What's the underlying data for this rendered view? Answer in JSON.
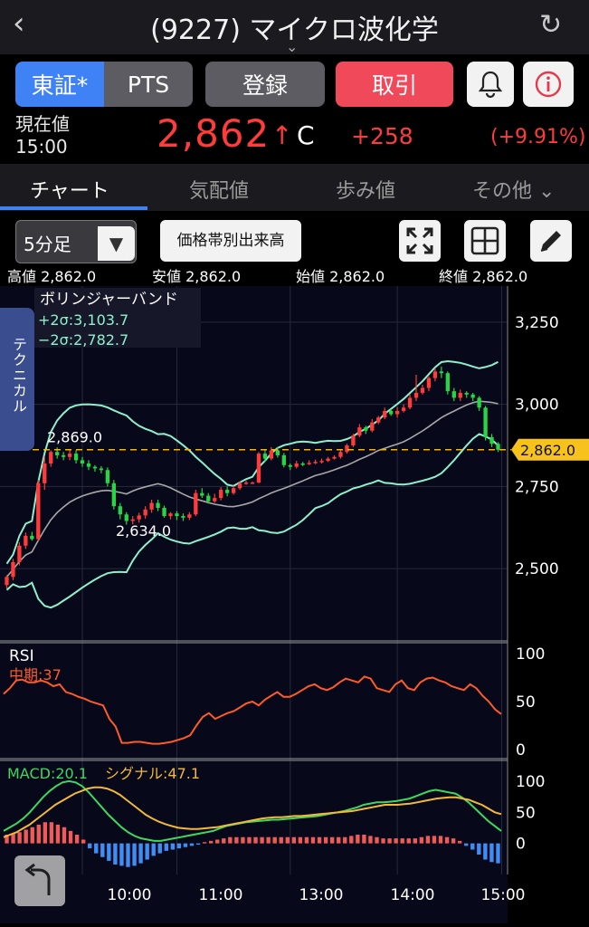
{
  "header": {
    "back_icon": "chevron-left-icon",
    "title": "(9227) マイクロ波化学",
    "reload_icon": "reload-icon"
  },
  "buttons": {
    "tse": "東証*",
    "pts": "PTS",
    "register": "登録",
    "trade": "取引"
  },
  "price": {
    "label_now": "現在値",
    "time": "15:00",
    "value": "2,862",
    "mark": "C",
    "change": "+258",
    "change_pct": "(+9.91%)",
    "up_color": "#ff3b3b"
  },
  "tabs": [
    "チャート",
    "気配値",
    "歩み値",
    "その他"
  ],
  "toolbar": {
    "interval": "5分足",
    "volume_by_price": "価格帯別出来高"
  },
  "ohlc": {
    "high_lbl": "高値",
    "high": "2,862.0",
    "low_lbl": "安値",
    "low": "2,862.0",
    "open_lbl": "始値",
    "open": "2,862.0",
    "close_lbl": "終値",
    "close": "2,862.0"
  },
  "technical_tab": "テクニカル",
  "chart_data": {
    "type": "candlestick",
    "x_ticks": [
      "10:00",
      "11:00",
      "13:00",
      "14:00",
      "15:00"
    ],
    "price_axis": {
      "ticks": [
        "3,250",
        "3,000",
        "2,750",
        "2,500"
      ],
      "values": [
        3250,
        3000,
        2750,
        2500
      ],
      "ylim": [
        2280,
        3360
      ]
    },
    "bollinger": {
      "title": "ボリンジャーバンド",
      "upper_label": "+2σ:3,103.7",
      "lower_label": "−2σ:2,782.7"
    },
    "annotations": {
      "high_mark": "2,869.0",
      "low_mark": "2,634.0",
      "current": "2,862.0",
      "current_value": 2862
    },
    "candles": [
      [
        2450,
        2475,
        2440,
        2480
      ],
      [
        2475,
        2520,
        2465,
        2530
      ],
      [
        2520,
        2570,
        2510,
        2580
      ],
      [
        2570,
        2600,
        2560,
        2610
      ],
      [
        2600,
        2590,
        2585,
        2612
      ],
      [
        2590,
        2760,
        2585,
        2770
      ],
      [
        2760,
        2820,
        2740,
        2840
      ],
      [
        2820,
        2855,
        2810,
        2860
      ],
      [
        2855,
        2845,
        2835,
        2869
      ],
      [
        2845,
        2840,
        2830,
        2855
      ],
      [
        2840,
        2850,
        2830,
        2860
      ],
      [
        2850,
        2830,
        2820,
        2860
      ],
      [
        2830,
        2820,
        2810,
        2840
      ],
      [
        2820,
        2810,
        2800,
        2830
      ],
      [
        2810,
        2805,
        2795,
        2815
      ],
      [
        2805,
        2800,
        2790,
        2812
      ],
      [
        2800,
        2760,
        2750,
        2808
      ],
      [
        2760,
        2690,
        2680,
        2770
      ],
      [
        2690,
        2665,
        2650,
        2700
      ],
      [
        2665,
        2645,
        2634,
        2672
      ],
      [
        2645,
        2650,
        2635,
        2660
      ],
      [
        2650,
        2662,
        2640,
        2670
      ],
      [
        2662,
        2680,
        2652,
        2690
      ],
      [
        2680,
        2700,
        2670,
        2710
      ],
      [
        2700,
        2685,
        2675,
        2710
      ],
      [
        2685,
        2660,
        2655,
        2692
      ],
      [
        2660,
        2668,
        2650,
        2672
      ],
      [
        2668,
        2660,
        2648,
        2675
      ],
      [
        2660,
        2655,
        2645,
        2668
      ],
      [
        2655,
        2665,
        2648,
        2672
      ],
      [
        2665,
        2730,
        2660,
        2740
      ],
      [
        2730,
        2722,
        2715,
        2745
      ],
      [
        2722,
        2705,
        2698,
        2730
      ],
      [
        2705,
        2715,
        2700,
        2728
      ],
      [
        2715,
        2740,
        2708,
        2748
      ],
      [
        2740,
        2730,
        2720,
        2750
      ],
      [
        2730,
        2745,
        2725,
        2752
      ],
      [
        2745,
        2760,
        2740,
        2765
      ],
      [
        2760,
        2762,
        2755,
        2768
      ],
      [
        2762,
        2762,
        2760,
        2765
      ],
      [
        2762,
        2850,
        2760,
        2855
      ],
      [
        2850,
        2835,
        2825,
        2860
      ],
      [
        2835,
        2860,
        2830,
        2870
      ],
      [
        2860,
        2845,
        2838,
        2870
      ],
      [
        2845,
        2815,
        2808,
        2852
      ],
      [
        2815,
        2810,
        2800,
        2820
      ],
      [
        2810,
        2820,
        2805,
        2828
      ],
      [
        2820,
        2818,
        2812,
        2825
      ],
      [
        2818,
        2822,
        2815,
        2830
      ],
      [
        2822,
        2825,
        2818,
        2832
      ],
      [
        2825,
        2828,
        2820,
        2835
      ],
      [
        2828,
        2835,
        2825,
        2840
      ],
      [
        2835,
        2840,
        2832,
        2845
      ],
      [
        2840,
        2855,
        2835,
        2860
      ],
      [
        2855,
        2875,
        2850,
        2880
      ],
      [
        2875,
        2905,
        2870,
        2910
      ],
      [
        2905,
        2930,
        2900,
        2940
      ],
      [
        2930,
        2920,
        2910,
        2935
      ],
      [
        2920,
        2945,
        2915,
        2955
      ],
      [
        2945,
        2960,
        2940,
        2965
      ],
      [
        2960,
        2980,
        2955,
        2990
      ],
      [
        2980,
        2970,
        2965,
        2985
      ],
      [
        2970,
        2980,
        2960,
        2992
      ],
      [
        2980,
        2990,
        2975,
        3000
      ],
      [
        2990,
        3020,
        2985,
        3030
      ],
      [
        3020,
        3035,
        3010,
        3090
      ],
      [
        3035,
        3050,
        3030,
        3060
      ],
      [
        3050,
        3080,
        3040,
        3085
      ],
      [
        3080,
        3100,
        3070,
        3110
      ],
      [
        3100,
        3095,
        3080,
        3115
      ],
      [
        3095,
        3040,
        3030,
        3100
      ],
      [
        3040,
        3020,
        3010,
        3050
      ],
      [
        3020,
        3035,
        3010,
        3045
      ],
      [
        3035,
        3030,
        3020,
        3040
      ],
      [
        3030,
        3020,
        3010,
        3035
      ],
      [
        3020,
        2990,
        2980,
        3025
      ],
      [
        2990,
        2900,
        2890,
        2995
      ],
      [
        2900,
        2880,
        2870,
        2910
      ],
      [
        2880,
        2862,
        2855,
        2885
      ]
    ],
    "rsi": {
      "label": "RSI",
      "mid_label": "中期:37",
      "ticks": [
        "100",
        "50",
        "0"
      ],
      "ylim": [
        0,
        100
      ],
      "values": [
        58,
        64,
        72,
        73,
        70,
        70,
        72,
        70,
        66,
        68,
        60,
        58,
        55,
        53,
        50,
        48,
        46,
        32,
        24,
        7,
        7,
        8,
        8,
        7,
        6,
        6,
        7,
        8,
        10,
        12,
        15,
        25,
        34,
        38,
        32,
        35,
        38,
        40,
        44,
        48,
        50,
        46,
        52,
        56,
        60,
        55,
        55,
        58,
        62,
        66,
        68,
        64,
        62,
        65,
        70,
        74,
        72,
        70,
        76,
        74,
        64,
        62,
        60,
        68,
        72,
        64,
        62,
        70,
        74,
        75,
        72,
        70,
        66,
        64,
        62,
        68,
        64,
        56,
        50,
        42,
        37
      ]
    },
    "macd": {
      "macd_label": "MACD:20.1",
      "signal_label": "シグナル:47.1",
      "ticks": [
        "100",
        "50",
        "0"
      ],
      "ylim": [
        -50,
        110
      ],
      "macd": [
        20,
        26,
        32,
        40,
        50,
        62,
        74,
        84,
        92,
        98,
        100,
        98,
        92,
        82,
        70,
        58,
        46,
        36,
        26,
        18,
        12,
        8,
        6,
        4,
        4,
        6,
        8,
        10,
        12,
        14,
        16,
        18,
        20,
        24,
        28,
        30,
        32,
        34,
        35,
        36,
        37,
        38,
        38,
        39,
        40,
        41,
        42,
        43,
        44,
        46,
        48,
        50,
        52,
        55,
        58,
        62,
        64,
        66,
        66,
        67,
        68,
        70,
        72,
        76,
        80,
        84,
        86,
        84,
        82,
        80,
        74,
        66,
        56,
        46,
        36,
        28,
        20
      ],
      "signal": [
        10,
        14,
        18,
        24,
        30,
        38,
        46,
        54,
        62,
        68,
        74,
        80,
        84,
        88,
        90,
        90,
        88,
        84,
        78,
        70,
        62,
        54,
        46,
        40,
        35,
        31,
        28,
        25,
        24,
        23,
        23,
        24,
        25,
        26,
        28,
        30,
        32,
        34,
        36,
        38,
        40,
        41,
        42,
        42,
        43,
        44,
        44,
        45,
        46,
        47,
        48,
        49,
        50,
        51,
        52,
        54,
        56,
        58,
        60,
        62,
        62,
        62,
        63,
        64,
        66,
        68,
        70,
        72,
        73,
        74,
        74,
        72,
        70,
        66,
        62,
        56,
        50,
        47
      ],
      "hist": [
        14,
        16,
        18,
        22,
        26,
        30,
        34,
        34,
        30,
        26,
        20,
        14,
        6,
        -8,
        -16,
        -22,
        -28,
        -34,
        -36,
        -38,
        -36,
        -32,
        -26,
        -20,
        -16,
        -12,
        -10,
        -8,
        -6,
        -4,
        -2,
        2,
        4,
        6,
        8,
        10,
        10,
        10,
        10,
        10,
        10,
        10,
        10,
        10,
        10,
        10,
        10,
        10,
        10,
        10,
        10,
        10,
        10,
        10,
        12,
        14,
        14,
        12,
        10,
        8,
        8,
        8,
        8,
        8,
        8,
        10,
        12,
        12,
        12,
        10,
        8,
        4,
        -4,
        -10,
        -18,
        -26,
        -30,
        -32
      ]
    }
  }
}
